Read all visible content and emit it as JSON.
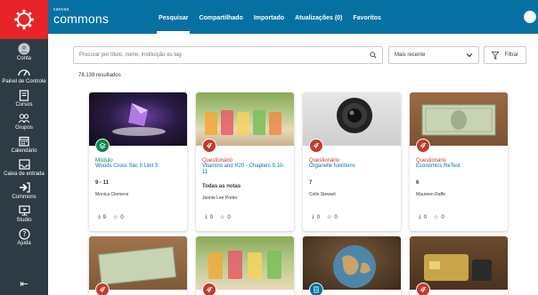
{
  "nav": {
    "items": [
      {
        "label": "Conta",
        "icon": "account-icon"
      },
      {
        "label": "Painel de Controle",
        "icon": "dashboard-icon"
      },
      {
        "label": "Cursos",
        "icon": "courses-icon"
      },
      {
        "label": "Grupos",
        "icon": "groups-icon"
      },
      {
        "label": "Calendário",
        "icon": "calendar-icon"
      },
      {
        "label": "Caixa de entrada",
        "icon": "inbox-icon"
      },
      {
        "label": "Commons",
        "icon": "commons-icon"
      },
      {
        "label": "Studio",
        "icon": "studio-icon"
      },
      {
        "label": "Ajuda",
        "icon": "help-icon"
      }
    ],
    "collapse_icon": "collapse-nav-icon"
  },
  "header": {
    "brand_small": "canvas",
    "brand_big": "commons",
    "tabs": [
      {
        "label": "Pesquisar",
        "active": true
      },
      {
        "label": "Compartilhado",
        "active": false
      },
      {
        "label": "Importado",
        "active": false
      },
      {
        "label": "Atualizações (0)",
        "active": false
      },
      {
        "label": "Favoritos",
        "active": false
      }
    ]
  },
  "search": {
    "placeholder": "Procurar por título, nome, instituição ou tag",
    "sort_value": "Mais recente",
    "filter_label": "Filtrar"
  },
  "results_text": "78.139 resultados",
  "colors": {
    "topbar": "#0770a3",
    "nav": "#2d3b45",
    "logo": "#e72429",
    "module": "#0b874b",
    "quiz": "#c23c2d",
    "page": "#0770a3"
  },
  "cards": [
    {
      "type": "Módulo",
      "type_color": "#0b874b",
      "title": "Woods Cross Sec II Unit 3",
      "grade": "9 - 11",
      "author": "Monica Clemens",
      "downloads": "9",
      "favorites": "0",
      "badge_icon": "module-icon",
      "image": "purple-crystal"
    },
    {
      "type": "Questionário",
      "type_color": "#c23c2d",
      "title": "Vitamins and H20 - Chapters 9,10-11",
      "grade": "Todas as notas",
      "author": "Jennie Lee Porter",
      "downloads": "0",
      "favorites": "0",
      "badge_icon": "rocket-icon",
      "image": "drink-jars"
    },
    {
      "type": "Questionário",
      "type_color": "#c23c2d",
      "title": "Organelle functions",
      "grade": "7",
      "author": "Colin Stewart",
      "downloads": "0",
      "favorites": "0",
      "badge_icon": "rocket-icon",
      "image": "camera-lens"
    },
    {
      "type": "Questionário",
      "type_color": "#c23c2d",
      "title": "Economics ReTest",
      "grade": "6",
      "author": "Maureen Raffe",
      "downloads": "0",
      "favorites": "0",
      "badge_icon": "rocket-icon",
      "image": "dollar-bill"
    },
    {
      "badge_icon": "rocket-icon",
      "badge_color": "#c23c2d",
      "image": "dollar-bill"
    },
    {
      "badge_icon": "rocket-icon",
      "badge_color": "#c23c2d",
      "image": "drink-jars"
    },
    {
      "badge_icon": "page-icon",
      "badge_color": "#0770a3",
      "image": "globe"
    },
    {
      "badge_icon": "rocket-icon",
      "badge_color": "#c23c2d",
      "image": "cards"
    }
  ]
}
